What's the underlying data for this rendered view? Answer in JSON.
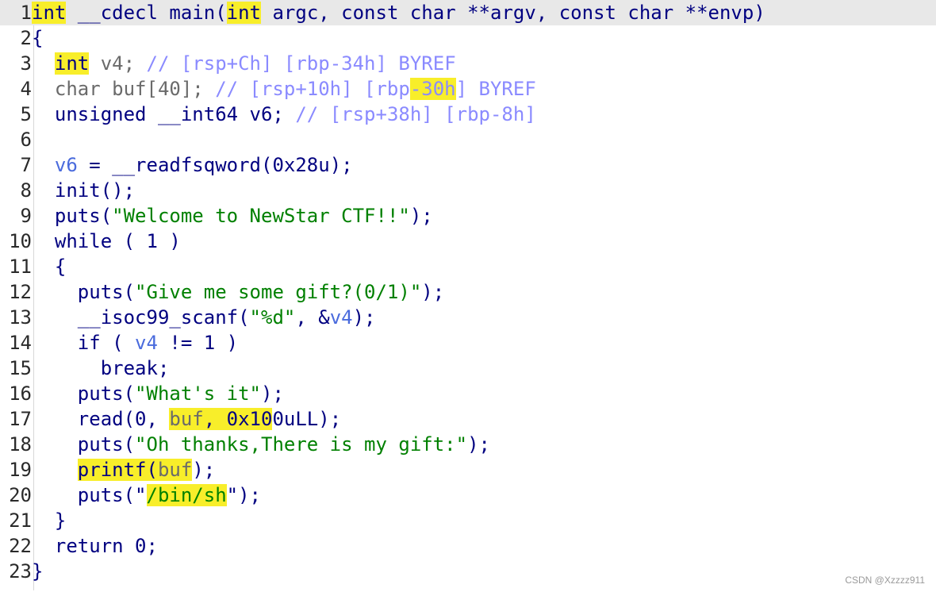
{
  "editor": {
    "lines": [
      {
        "num": "1",
        "tokens": [
          {
            "t": "int",
            "c": "t-k t-h"
          },
          {
            "t": " __cdecl main(",
            "c": "t-n"
          },
          {
            "t": "int",
            "c": "t-k t-h"
          },
          {
            "t": " argc, const char **argv, const char **envp)",
            "c": "t-n"
          }
        ]
      },
      {
        "num": "2",
        "tokens": [
          {
            "t": "{",
            "c": "t-n"
          }
        ]
      },
      {
        "num": "3",
        "tokens": [
          {
            "t": "  ",
            "c": "t-n"
          },
          {
            "t": "int",
            "c": "t-k t-h"
          },
          {
            "t": " v4; ",
            "c": "t-m"
          },
          {
            "t": "// [rsp+Ch] [rbp-34h] BYREF",
            "c": "t-g"
          }
        ]
      },
      {
        "num": "4",
        "tokens": [
          {
            "t": "  char buf[40]; ",
            "c": "t-m"
          },
          {
            "t": "// [rsp+10h] [rbp",
            "c": "t-g"
          },
          {
            "t": "-30h",
            "c": "t-g t-h"
          },
          {
            "t": "] BYREF",
            "c": "t-g"
          }
        ]
      },
      {
        "num": "5",
        "tokens": [
          {
            "t": "  unsigned __int64 v6; ",
            "c": "t-n"
          },
          {
            "t": "// [rsp+38h] [rbp-8h]",
            "c": "t-g"
          }
        ]
      },
      {
        "num": "6",
        "tokens": [
          {
            "t": "",
            "c": "t-n"
          }
        ]
      },
      {
        "num": "7",
        "tokens": [
          {
            "t": "  ",
            "c": "t-n"
          },
          {
            "t": "v6",
            "c": "t-v"
          },
          {
            "t": " = __readfsqword(0x28u);",
            "c": "t-n"
          }
        ]
      },
      {
        "num": "8",
        "tokens": [
          {
            "t": "  init();",
            "c": "t-n"
          }
        ]
      },
      {
        "num": "9",
        "tokens": [
          {
            "t": "  puts(",
            "c": "t-n"
          },
          {
            "t": "\"Welcome to NewStar CTF!!\"",
            "c": "t-s"
          },
          {
            "t": ");",
            "c": "t-n"
          }
        ]
      },
      {
        "num": "10",
        "tokens": [
          {
            "t": "  while ( 1 )",
            "c": "t-n"
          }
        ]
      },
      {
        "num": "11",
        "tokens": [
          {
            "t": "  {",
            "c": "t-n"
          }
        ]
      },
      {
        "num": "12",
        "tokens": [
          {
            "t": "    puts(",
            "c": "t-n"
          },
          {
            "t": "\"Give me some gift?(0/1)\"",
            "c": "t-s"
          },
          {
            "t": ");",
            "c": "t-n"
          }
        ]
      },
      {
        "num": "13",
        "tokens": [
          {
            "t": "    __isoc99_scanf(",
            "c": "t-n"
          },
          {
            "t": "\"%d\"",
            "c": "t-s"
          },
          {
            "t": ", &",
            "c": "t-n"
          },
          {
            "t": "v4",
            "c": "t-v"
          },
          {
            "t": ");",
            "c": "t-n"
          }
        ]
      },
      {
        "num": "14",
        "tokens": [
          {
            "t": "    if ( ",
            "c": "t-n"
          },
          {
            "t": "v4",
            "c": "t-v"
          },
          {
            "t": " != 1 )",
            "c": "t-n"
          }
        ]
      },
      {
        "num": "15",
        "tokens": [
          {
            "t": "      break;",
            "c": "t-n"
          }
        ]
      },
      {
        "num": "16",
        "tokens": [
          {
            "t": "    puts(",
            "c": "t-n"
          },
          {
            "t": "\"What's it\"",
            "c": "t-s"
          },
          {
            "t": ");",
            "c": "t-n"
          }
        ]
      },
      {
        "num": "17",
        "tokens": [
          {
            "t": "    read(0, ",
            "c": "t-n"
          },
          {
            "t": "buf",
            "c": "t-m t-h"
          },
          {
            "t": ", 0x10",
            "c": "t-n t-h"
          },
          {
            "t": "0uLL);",
            "c": "t-n"
          }
        ]
      },
      {
        "num": "18",
        "tokens": [
          {
            "t": "    puts(",
            "c": "t-n"
          },
          {
            "t": "\"Oh thanks,There is my gift:\"",
            "c": "t-s"
          },
          {
            "t": ");",
            "c": "t-n"
          }
        ]
      },
      {
        "num": "19",
        "tokens": [
          {
            "t": "    ",
            "c": "t-n"
          },
          {
            "t": "printf(",
            "c": "t-n t-h"
          },
          {
            "t": "buf",
            "c": "t-m t-h"
          },
          {
            "t": ");",
            "c": "t-n"
          }
        ]
      },
      {
        "num": "20",
        "tokens": [
          {
            "t": "    puts(\"",
            "c": "t-n"
          },
          {
            "t": "/bin/sh",
            "c": "t-s t-h"
          },
          {
            "t": "\");",
            "c": "t-n"
          }
        ]
      },
      {
        "num": "21",
        "tokens": [
          {
            "t": "  }",
            "c": "t-n"
          }
        ]
      },
      {
        "num": "22",
        "tokens": [
          {
            "t": "  return 0;",
            "c": "t-n"
          }
        ]
      },
      {
        "num": "23",
        "tokens": [
          {
            "t": "}",
            "c": "t-n"
          }
        ]
      }
    ]
  },
  "watermark": "CSDN @Xzzzz911",
  "colors": {
    "keyword": "#000080",
    "string": "#008000",
    "comment": "#8a8aff",
    "variable": "#4a6bdd",
    "highlight": "#f8ee2a",
    "current_line": "#e8e8e8"
  }
}
